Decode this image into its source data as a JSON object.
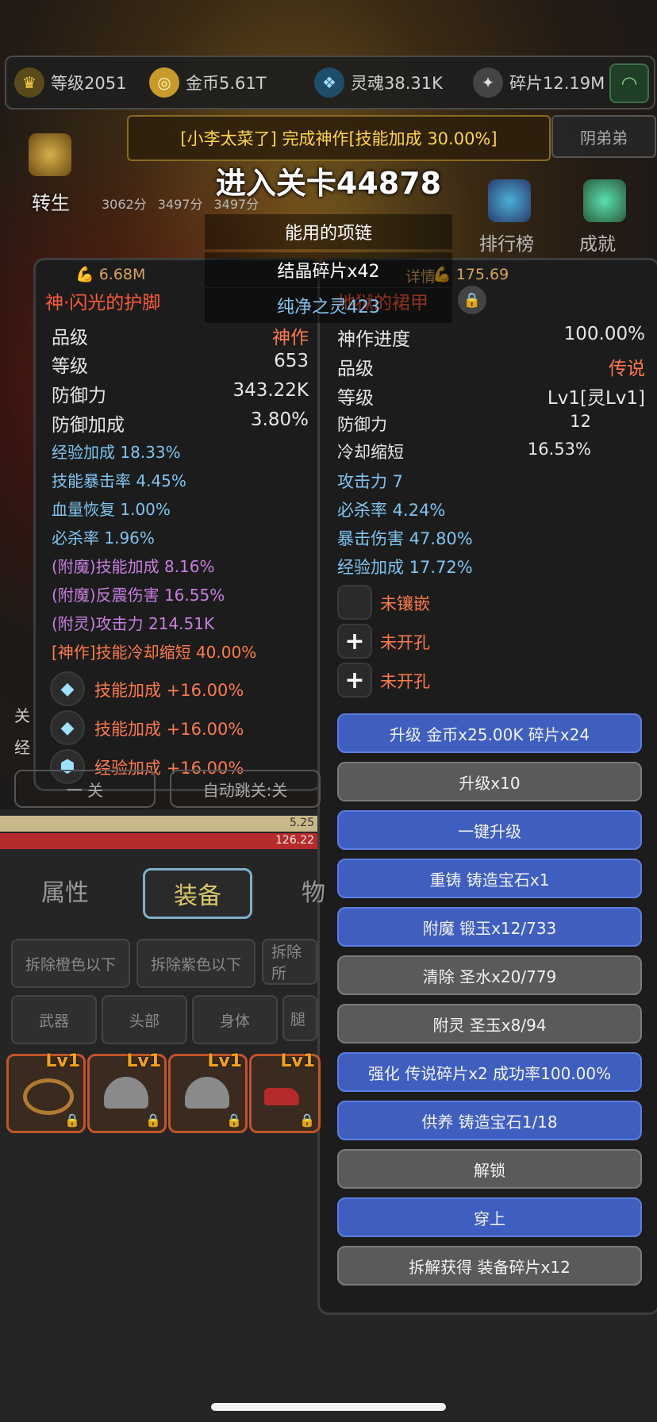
{
  "resources": [
    {
      "icon": "crown-icon",
      "value": "等级2051"
    },
    {
      "icon": "coin-icon",
      "value": "金币5.61T"
    },
    {
      "icon": "soul-icon",
      "value": "灵魂38.31K"
    },
    {
      "icon": "shard-icon",
      "value": "碎片12.19M"
    }
  ],
  "notice": "[小李太菜了] 完成神作[技能加成 30.00%]",
  "side_name": "阴弟弟",
  "stage_title": "进入关卡44878",
  "reborn_label": "转生",
  "scores": [
    "3062分",
    "3497分",
    "3497分"
  ],
  "rank_label": "排行榜",
  "achievement_label": "成就",
  "loot_banners": [
    "能用的项链",
    "结晶碎片x42",
    "纯净之灵423"
  ],
  "left_item": {
    "power_left": "6.68M",
    "name": "神·闪光的护脚",
    "rows": [
      {
        "label": "品级",
        "value": "神作"
      },
      {
        "label": "等级",
        "value": "653"
      },
      {
        "label": "防御力",
        "value": "343.22K"
      },
      {
        "label": "防御加成",
        "value": "3.80%"
      }
    ],
    "attrs_blue": [
      "经验加成 18.33%",
      "技能暴击率 4.45%",
      "血量恢复 1.00%",
      "必杀率 1.96%"
    ],
    "attrs_purple": [
      "(附魔)技能加成 8.16%",
      "(附魔)反震伤害 16.55%",
      "(附灵)攻击力 214.51K"
    ],
    "attr_orange": "[神作]技能冷却缩短 40.00%",
    "gems": [
      "技能加成 +16.00%",
      "技能加成 +16.00%",
      "经验加成 +16.00%"
    ]
  },
  "right_item": {
    "power_label": "详情",
    "power_right": "175.69",
    "name": "地狱的裙甲",
    "rows": [
      {
        "label": "神作进度",
        "value": "100.00%"
      },
      {
        "label": "品级",
        "value": "传说"
      },
      {
        "label": "等级",
        "value": "Lv1[灵Lv1]"
      },
      {
        "label": "防御力",
        "value": "12"
      },
      {
        "label": "冷却缩短",
        "value": "16.53%"
      }
    ],
    "attrs_blue": [
      "攻击力 7",
      "必杀率 4.24%",
      "暴击伤害 47.80%",
      "经验加成 17.72%"
    ],
    "sockets": [
      "未镶嵌",
      "未开孔",
      "未开孔"
    ],
    "buttons": [
      {
        "label": "升级 金币x25.00K 碎片x24",
        "style": "blue"
      },
      {
        "label": "升级x10",
        "style": "gray"
      },
      {
        "label": "一键升级",
        "style": "blue"
      },
      {
        "label": "重铸 铸造宝石x1",
        "style": "blue"
      },
      {
        "label": "附魔 锻玉x12/733",
        "style": "blue"
      },
      {
        "label": "清除 圣水x20/779",
        "style": "gray"
      },
      {
        "label": "附灵 圣玉x8/94",
        "style": "gray"
      },
      {
        "label": "强化 传说碎片x2 成功率100.00%",
        "style": "blue"
      },
      {
        "label": "供养 铸造宝石1/18",
        "style": "blue"
      },
      {
        "label": "解锁",
        "style": "gray"
      },
      {
        "label": "穿上",
        "style": "blue"
      },
      {
        "label": "拆解获得 装备碎片x12",
        "style": "gray"
      }
    ]
  },
  "under": {
    "side_labels": [
      "关",
      "经"
    ],
    "btn1": "一 关",
    "btn2": "自动跳关:关",
    "hp1": "5.25",
    "hp2": "126.22",
    "tabs": [
      "属性",
      "装备",
      "物"
    ],
    "dismantle": [
      "拆除橙色以下",
      "拆除紫色以下",
      "拆除所"
    ],
    "filters": [
      "武器",
      "头部",
      "身体",
      "腿"
    ],
    "slot_level": "Lv1"
  },
  "colors": {
    "accent_blue": "#3f5fc0",
    "legendary_orange": "#ff7a4c",
    "gold": "#ffd54a"
  }
}
